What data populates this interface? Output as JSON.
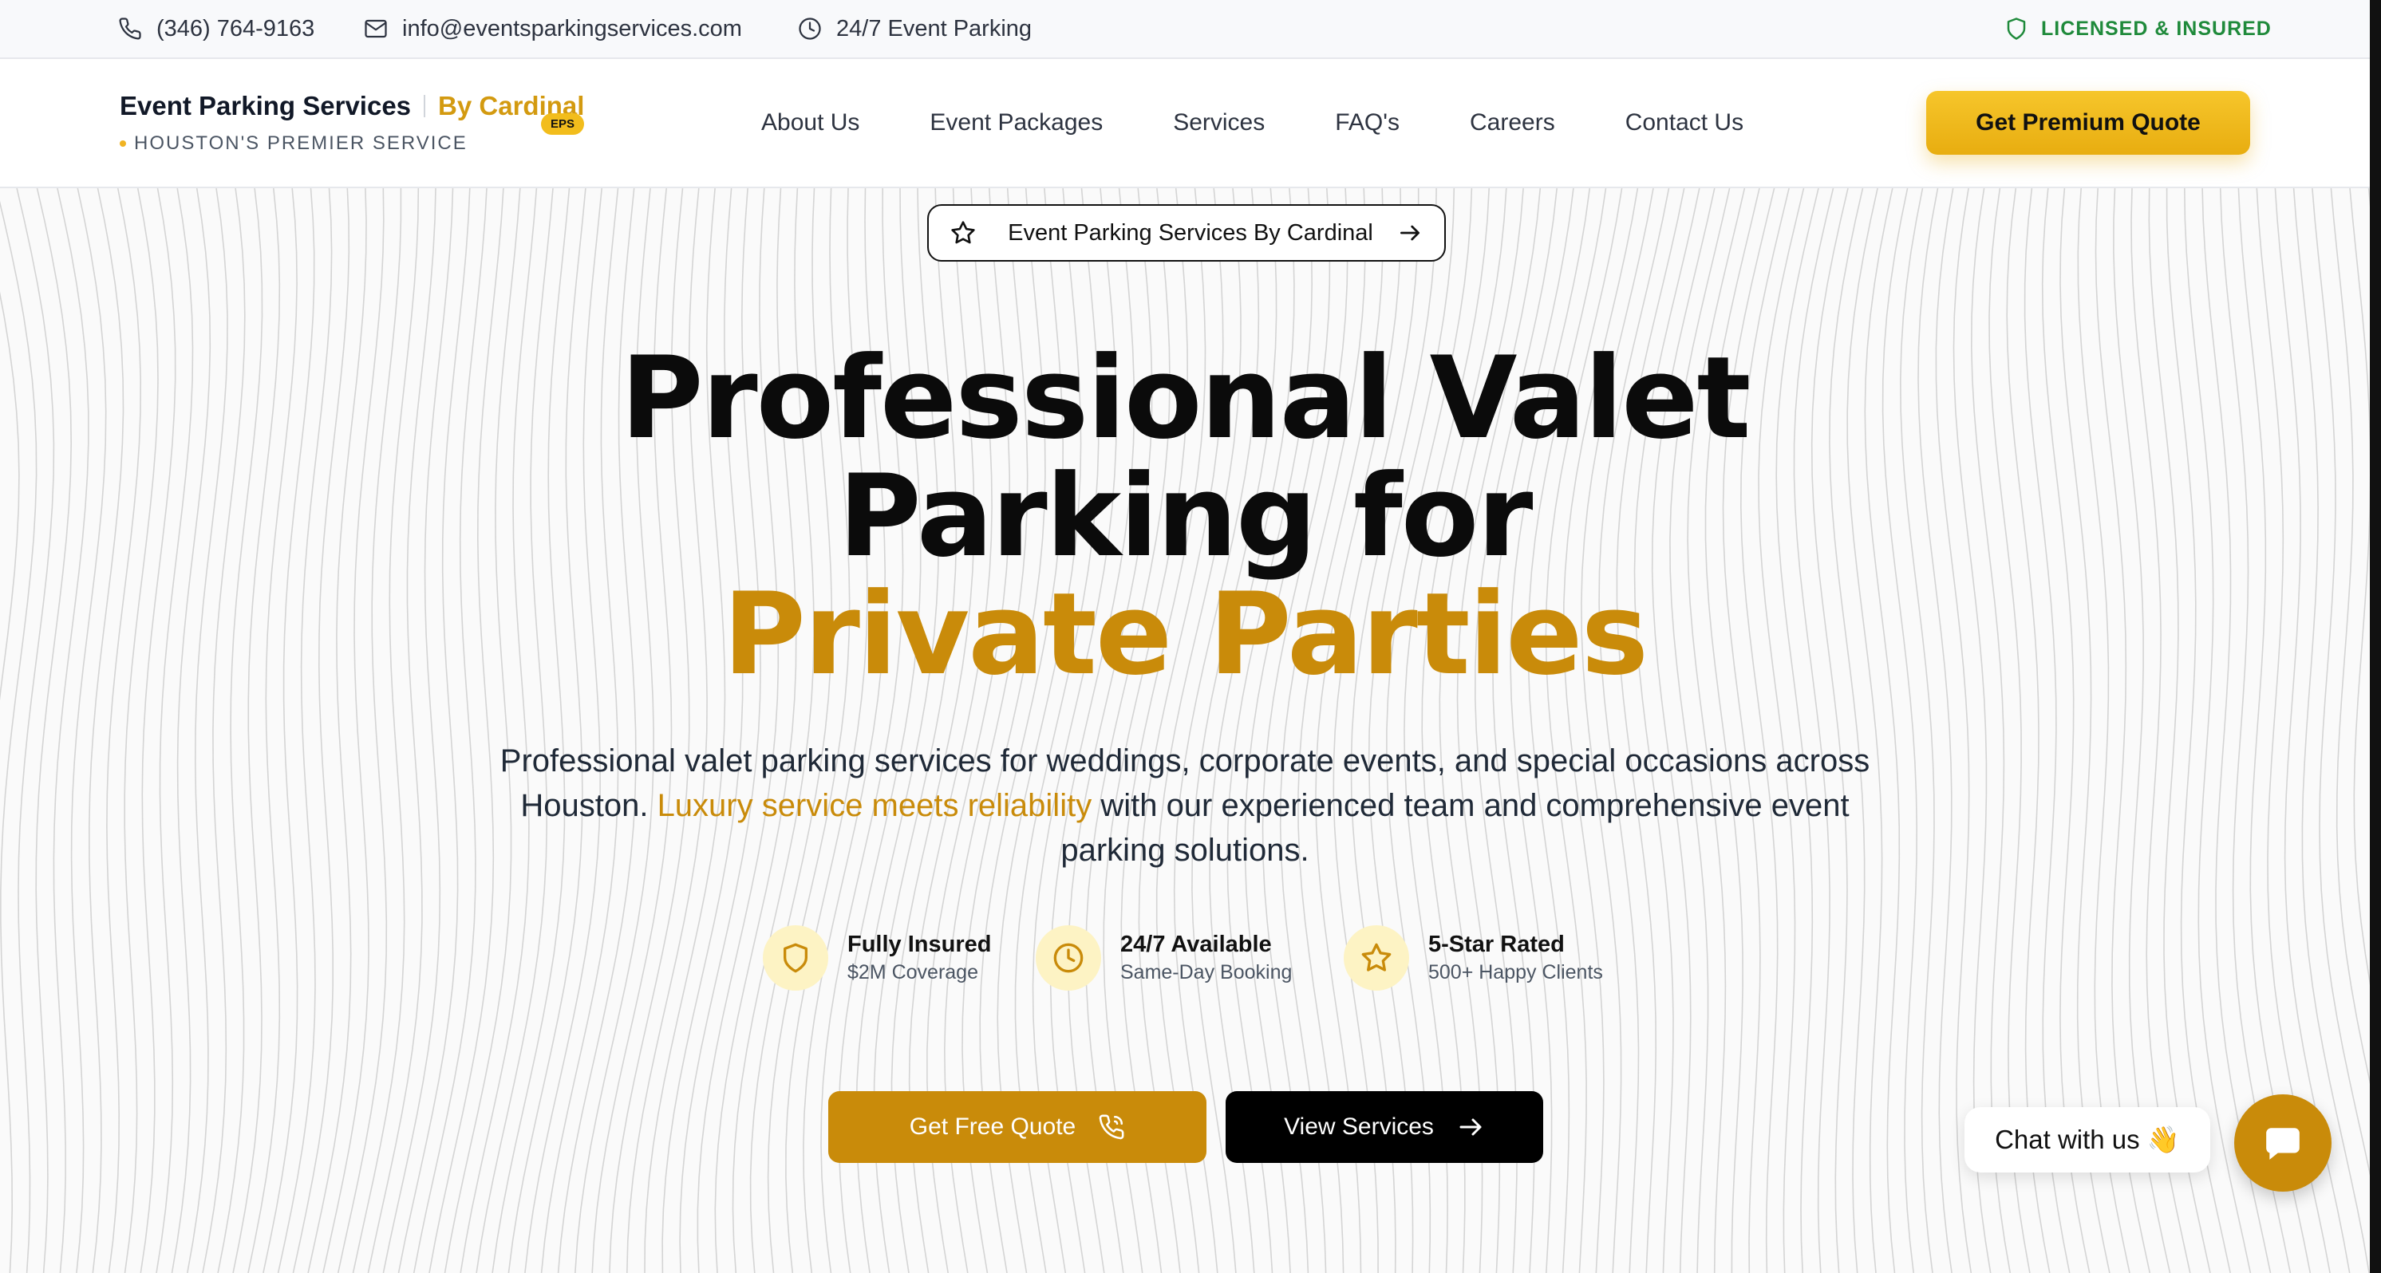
{
  "topbar": {
    "phone": "(346) 764-9163",
    "email": "info@eventsparkingservices.com",
    "hours": "24/7 Event Parking",
    "licensed": "LICENSED & INSURED",
    "icons": [
      "phone-icon",
      "mail-icon",
      "clock-icon",
      "shield-icon"
    ]
  },
  "logo": {
    "main": "Event Parking Services",
    "by": "By Cardinal",
    "badge": "EPS",
    "tagline": "HOUSTON'S PREMIER SERVICE"
  },
  "nav": {
    "links": [
      "About Us",
      "Event Packages",
      "Services",
      "FAQ's",
      "Careers",
      "Contact Us"
    ],
    "cta": "Get Premium Quote"
  },
  "hero": {
    "pill": "Event Parking Services By Cardinal",
    "headline": {
      "line1": "Professional Valet",
      "line2": "Parking for",
      "line3": "Private Parties"
    },
    "sub": {
      "part1": "Professional valet parking services for weddings, corporate events, and special occasions across Houston. ",
      "highlight": "Luxury service meets reliability",
      "part2": " with our experienced team and comprehensive event parking solutions."
    },
    "features": [
      {
        "title": "Fully Insured",
        "sub": "$2M Coverage",
        "icon": "shield-icon"
      },
      {
        "title": "24/7 Available",
        "sub": "Same-Day Booking",
        "icon": "clock-icon"
      },
      {
        "title": "5-Star Rated",
        "sub": "500+ Happy Clients",
        "icon": "star-icon"
      }
    ],
    "btn_free": "Get Free Quote",
    "btn_services": "View Services"
  },
  "chat": {
    "label": "Chat with us 👋"
  },
  "colors": {
    "gold": "#c98b0a",
    "gold_button": "#f2bd1c",
    "licensed_green": "#1f8a3b",
    "dark": "#0b0b0b"
  }
}
